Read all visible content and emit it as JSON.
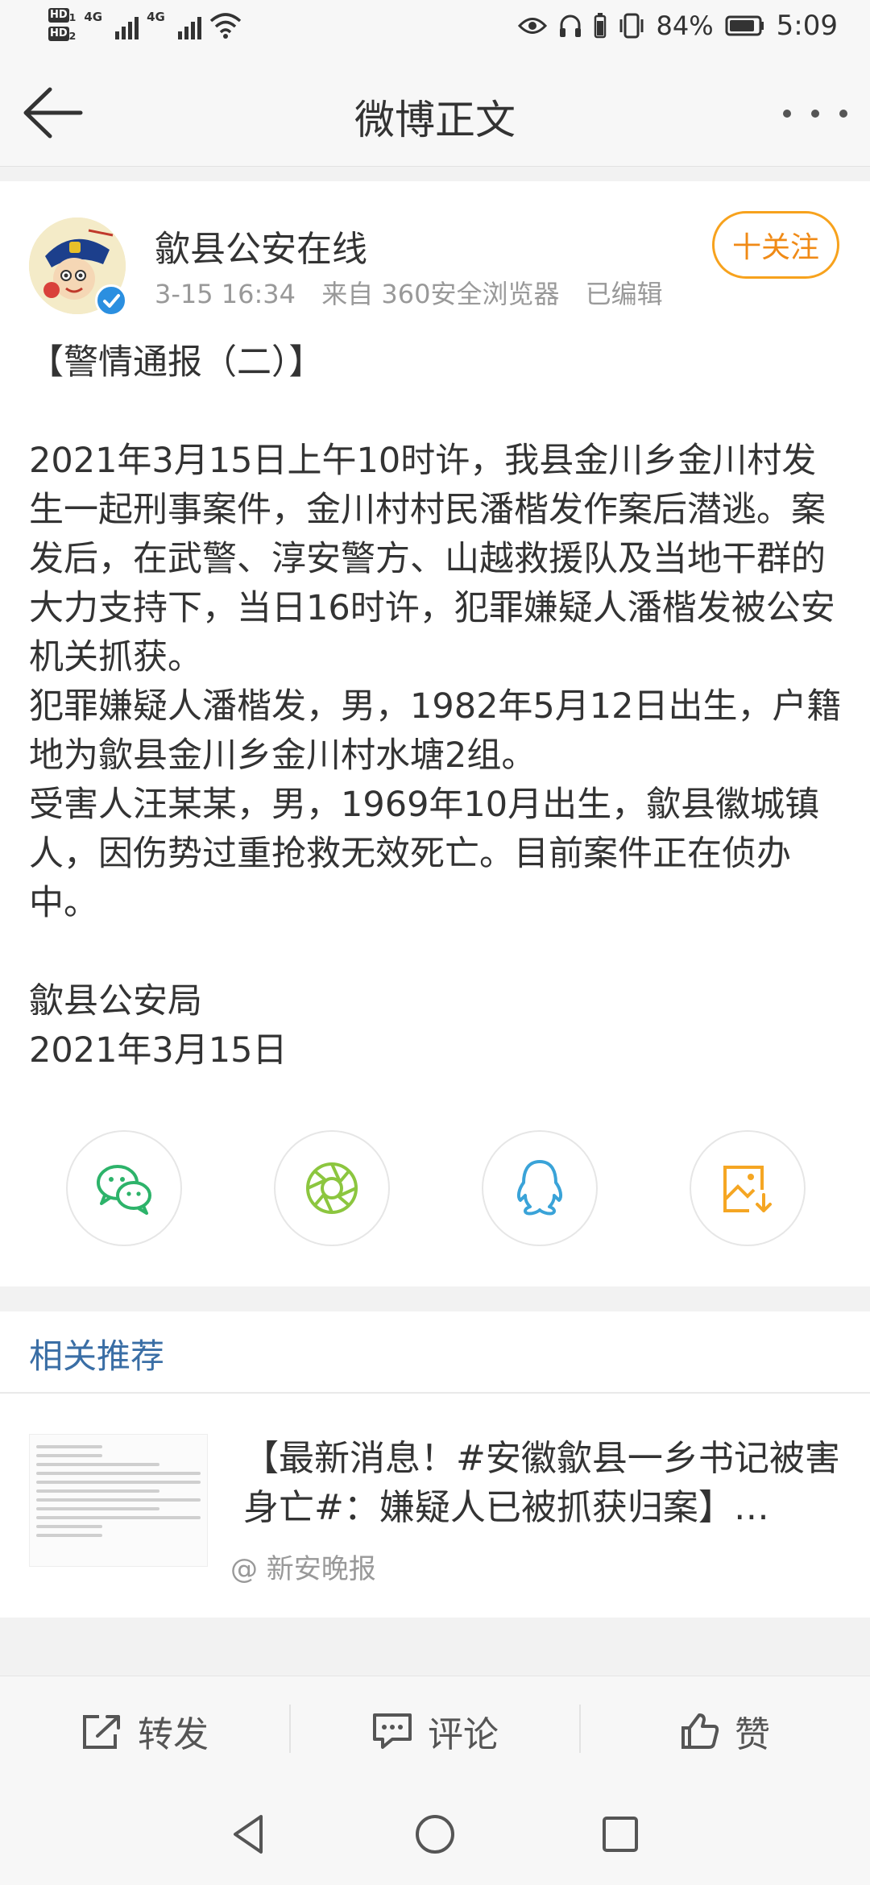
{
  "status_bar": {
    "hd1": "HD",
    "hd1_num": "1",
    "hd2": "HD",
    "hd2_num": "2",
    "net1": "4G",
    "net2": "4G",
    "battery_pct": "84%",
    "time": "5:09"
  },
  "header": {
    "title": "微博正文"
  },
  "post": {
    "author": "歙县公安在线",
    "time": "3-15 16:34",
    "source": "来自 360安全浏览器",
    "edited": "已编辑",
    "follow_label": "十关注",
    "body": [
      "【警情通报（二）】",
      "",
      "2021年3月15日上午10时许，我县金川乡金川村发生一起刑事案件，金川村村民潘楷发作案后潜逃。案发后，在武警、淳安警方、山越救援队及当地干群的大力支持下，当日16时许，犯罪嫌疑人潘楷发被公安机关抓获。",
      "犯罪嫌疑人潘楷发，男，1982年5月12日出生，户籍地为歙县金川乡金川村水塘2组。",
      "受害人汪某某，男，1969年10月出生，歙县徽城镇人，因伤势过重抢救无效死亡。目前案件正在侦办中。",
      "",
      "歙县公安局",
      "2021年3月15日"
    ]
  },
  "share": {
    "icons": [
      "wechat-icon",
      "moments-icon",
      "qq-icon",
      "save-image-icon"
    ]
  },
  "related": {
    "title": "相关推荐",
    "item": {
      "headline": "【最新消息！#安徽歙县一乡书记被害身亡#：嫌疑人已被抓获归案】…",
      "source": "@ 新安晚报"
    }
  },
  "actions": {
    "repost": "转发",
    "comment": "评论",
    "like": "赞"
  },
  "colors": {
    "accent_orange": "#f08a16",
    "link_blue": "#3a6ea5",
    "wechat_green": "#2db36a",
    "moments_green": "#8cc63f",
    "qq_blue": "#3aa3d8",
    "save_orange": "#f5a623"
  }
}
